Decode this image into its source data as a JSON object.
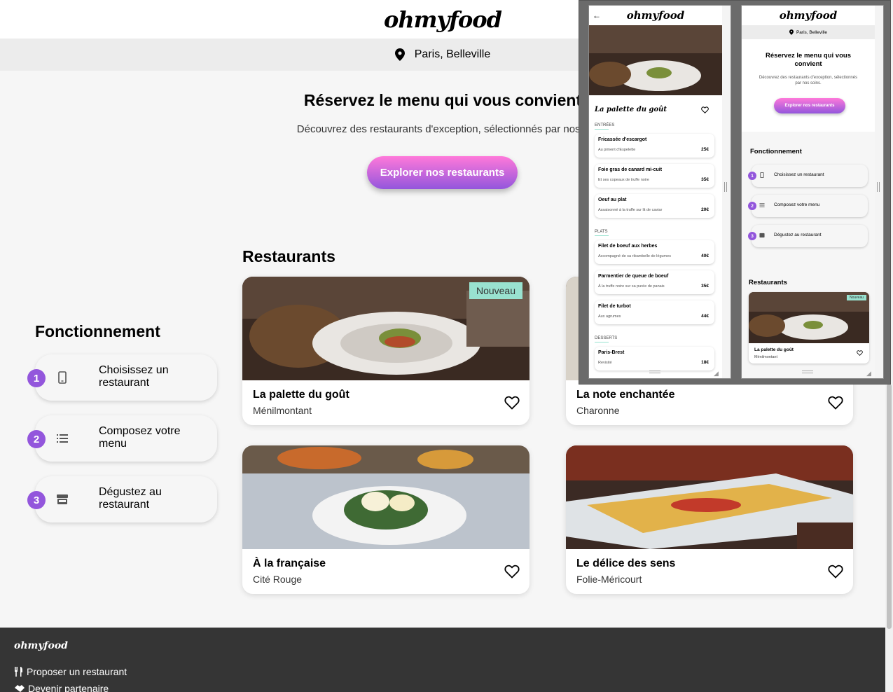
{
  "header": {
    "logo": "ohmyfood",
    "location": "Paris, Belleville"
  },
  "hero": {
    "title": "Réservez le menu qui vous convient",
    "subtitle": "Découvrez des restaurants d'exception, sélectionnés par nos s",
    "cta": "Explorer nos restaurants"
  },
  "how": {
    "title": "Fonctionnement",
    "steps": [
      {
        "num": "1",
        "label": "Choisissez un restaurant",
        "icon": "phone-icon"
      },
      {
        "num": "2",
        "label": "Composez votre menu",
        "icon": "list-icon"
      },
      {
        "num": "3",
        "label": "Dégustez au restaurant",
        "icon": "store-icon"
      }
    ]
  },
  "restaurants": {
    "title": "Restaurants",
    "badge": "Nouveau",
    "items": [
      {
        "name": "La palette du goût",
        "area": "Ménilmontant"
      },
      {
        "name": "La note enchantée",
        "area": "Charonne"
      },
      {
        "name": "À la française",
        "area": "Cité Rouge"
      },
      {
        "name": "Le délice des sens",
        "area": "Folie-Méricourt"
      }
    ]
  },
  "footer": {
    "logo": "ohmyfood",
    "links": [
      "Proposer un restaurant",
      "Devenir partenaire"
    ]
  },
  "preview_menu": {
    "logo": "ohmyfood",
    "restaurant": "La palette du goût",
    "sections": [
      {
        "title": "ENTRÉES",
        "items": [
          {
            "name": "Fricassée d'escargot",
            "desc": "Au piment d'Espelette",
            "price": "25€"
          },
          {
            "name": "Foie gras de canard mi-cuit",
            "desc": "Et ses copeaux de truffe noire",
            "price": "35€"
          },
          {
            "name": "Oeuf au plat",
            "desc": "Assaisonné à la truffe sur lit de caviar",
            "price": "20€"
          }
        ]
      },
      {
        "title": "PLATS",
        "items": [
          {
            "name": "Filet de boeuf aux herbes",
            "desc": "Accompagné de sa ribambelle de légumes",
            "price": "40€"
          },
          {
            "name": "Parmentier de queue de boeuf",
            "desc": "À la truffe noire sur sa purée de panais",
            "price": "35€"
          },
          {
            "name": "Filet de turbot",
            "desc": "Aux agrumes",
            "price": "44€"
          }
        ]
      },
      {
        "title": "DESSERTS",
        "items": [
          {
            "name": "Paris-Brest",
            "desc": "Revisité",
            "price": "18€"
          }
        ]
      }
    ]
  },
  "preview_home": {
    "logo": "ohmyfood",
    "location": "Paris, Belleville",
    "title": "Réservez le menu qui vous convient",
    "subtitle": "Découvrez des restaurants d'exception, sélectionnés par nos soins.",
    "cta": "Explorer nos restaurants",
    "how_title": "Fonctionnement",
    "steps": [
      "Choisissez un restaurant",
      "Composez votre menu",
      "Dégustez au restaurant"
    ],
    "rest_title": "Restaurants",
    "badge": "Nouveau",
    "card_name": "La palette du goût",
    "card_area": "Ménilmontant"
  },
  "colors": {
    "accent": "#9356dc",
    "gradient_top": "#ff79da",
    "badge": "#99e2d0",
    "footer": "#353535"
  }
}
